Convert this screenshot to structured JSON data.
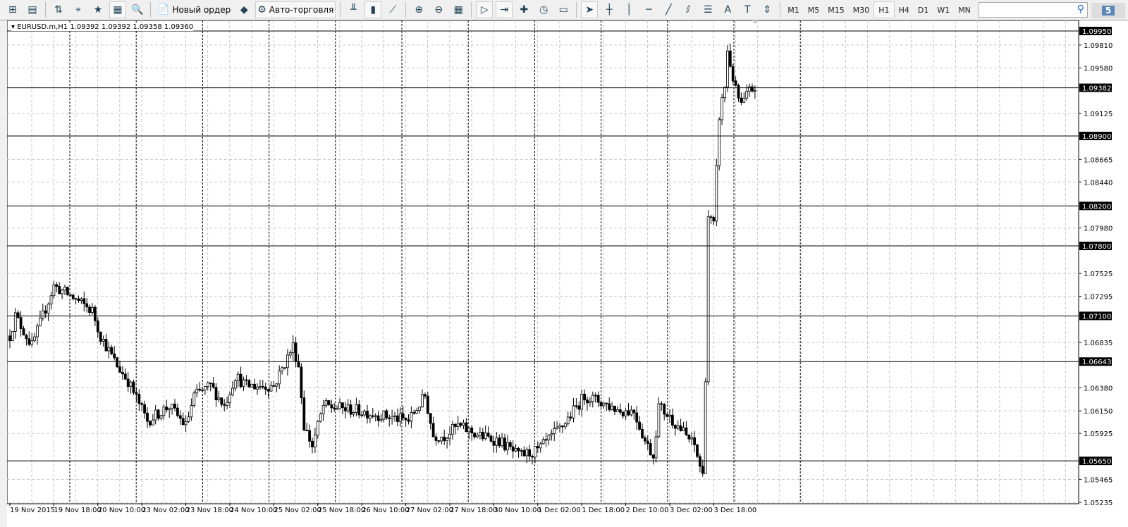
{
  "toolbar": {
    "buttons": [
      {
        "icon": "new-chart-icon",
        "glyph": "⊞"
      },
      {
        "icon": "profiles-icon",
        "glyph": "▤"
      },
      {
        "icon": "market-watch-icon",
        "glyph": "⇅"
      },
      {
        "icon": "crosshair-icon",
        "glyph": "⌖"
      },
      {
        "icon": "favorites-icon",
        "glyph": "★"
      },
      {
        "icon": "navigator-icon",
        "glyph": "▦"
      },
      {
        "icon": "strategy-tester-icon",
        "glyph": "🔍"
      }
    ],
    "new_order_label": "Новый ордер",
    "autotrading_label": "Авто-торговля",
    "tools": [
      {
        "icon": "bar-chart-icon",
        "glyph": "╨"
      },
      {
        "icon": "candlestick-icon",
        "glyph": "▮"
      },
      {
        "icon": "line-chart-icon",
        "glyph": "⟋"
      },
      {
        "icon": "zoom-in-icon",
        "glyph": "⊕"
      },
      {
        "icon": "zoom-out-icon",
        "glyph": "⊖"
      },
      {
        "icon": "tile-windows-icon",
        "glyph": "▦"
      },
      {
        "icon": "auto-scroll-icon",
        "glyph": "▷"
      },
      {
        "icon": "chart-shift-icon",
        "glyph": "⇥"
      },
      {
        "icon": "indicators-icon",
        "glyph": "✚"
      },
      {
        "icon": "periods-icon",
        "glyph": "◷"
      },
      {
        "icon": "templates-icon",
        "glyph": "▭"
      },
      {
        "icon": "cursor-icon",
        "glyph": "➤"
      },
      {
        "icon": "crosshair-tool-icon",
        "glyph": "┼"
      },
      {
        "icon": "vertical-line-icon",
        "glyph": "│"
      },
      {
        "icon": "horizontal-line-icon",
        "glyph": "─"
      },
      {
        "icon": "trendline-icon",
        "glyph": "╱"
      },
      {
        "icon": "equidistant-channel-icon",
        "glyph": "⫽"
      },
      {
        "icon": "fibonacci-icon",
        "glyph": "☰"
      },
      {
        "icon": "text-icon",
        "glyph": "A"
      },
      {
        "icon": "text-label-icon",
        "glyph": "T"
      },
      {
        "icon": "arrows-icon",
        "glyph": "⇕"
      }
    ],
    "timeframes": [
      "M1",
      "M5",
      "M15",
      "M30",
      "H1",
      "H4",
      "D1",
      "W1",
      "MN"
    ],
    "active_timeframe": "H1",
    "search_placeholder": "",
    "messages_count": "5"
  },
  "chart": {
    "title": "EURUSD.m,H1  1.09392 1.09392 1.09358 1.09360",
    "price_range": [
      1.05235,
      1.0995
    ],
    "price_ticks": [
      "1.09810",
      "1.09580",
      "1.09125",
      "1.08665",
      "1.08440",
      "1.07980",
      "1.07525",
      "1.07295",
      "1.06835",
      "1.06380",
      "1.06150",
      "1.05925",
      "1.05465",
      "1.05235"
    ],
    "hlines": [
      "1.09950",
      "1.09382",
      "1.08900",
      "1.08200",
      "1.07800",
      "1.07100",
      "1.06643",
      "1.05650"
    ],
    "time_labels": [
      "19 Nov 2015",
      "19 Nov 18:00",
      "20 Nov 10:00",
      "23 Nov 02:00",
      "23 Nov 18:00",
      "24 Nov 10:00",
      "25 Nov 02:00",
      "25 Nov 18:00",
      "26 Nov 10:00",
      "27 Nov 02:00",
      "27 Nov 18:00",
      "30 Nov 10:00",
      "1 Dec 02:00",
      "1 Dec 18:00",
      "2 Dec 10:00",
      "3 Dec 02:00",
      "3 Dec 18:00"
    ],
    "hours_per_label": 16,
    "price_path": [
      [
        0,
        1.069
      ],
      [
        2,
        1.071
      ],
      [
        8,
        1.068
      ],
      [
        16,
        1.074
      ],
      [
        22,
        1.073
      ],
      [
        30,
        1.0715
      ],
      [
        33,
        1.069
      ],
      [
        39,
        1.066
      ],
      [
        43,
        1.0645
      ],
      [
        50,
        1.0605
      ],
      [
        58,
        1.062
      ],
      [
        64,
        1.06
      ],
      [
        67,
        1.063
      ],
      [
        73,
        1.064
      ],
      [
        78,
        1.062
      ],
      [
        82,
        1.065
      ],
      [
        86,
        1.064
      ],
      [
        96,
        1.064
      ],
      [
        103,
        1.068
      ],
      [
        105,
        1.066
      ],
      [
        107,
        1.06
      ],
      [
        110,
        1.058
      ],
      [
        114,
        1.062
      ],
      [
        127,
        1.0615
      ],
      [
        136,
        1.061
      ],
      [
        145,
        1.0605
      ],
      [
        151,
        1.063
      ],
      [
        154,
        1.059
      ],
      [
        158,
        1.059
      ],
      [
        163,
        1.06
      ],
      [
        171,
        1.059
      ],
      [
        178,
        1.0585
      ],
      [
        185,
        1.057
      ],
      [
        192,
        1.0575
      ],
      [
        201,
        1.06
      ],
      [
        209,
        1.063
      ],
      [
        214,
        1.0625
      ],
      [
        222,
        1.0615
      ],
      [
        227,
        1.0615
      ],
      [
        231,
        1.0585
      ],
      [
        234,
        1.057
      ],
      [
        236,
        1.062
      ],
      [
        243,
        1.06
      ],
      [
        249,
        1.058
      ],
      [
        252,
        1.055
      ],
      [
        253,
        1.065
      ],
      [
        254,
        1.081
      ],
      [
        256,
        1.08
      ],
      [
        258,
        1.091
      ],
      [
        260,
        1.094
      ],
      [
        261,
        1.0975
      ],
      [
        264,
        1.0935
      ],
      [
        266,
        1.092
      ],
      [
        269,
        1.0935
      ],
      [
        271,
        1.0938
      ]
    ]
  }
}
